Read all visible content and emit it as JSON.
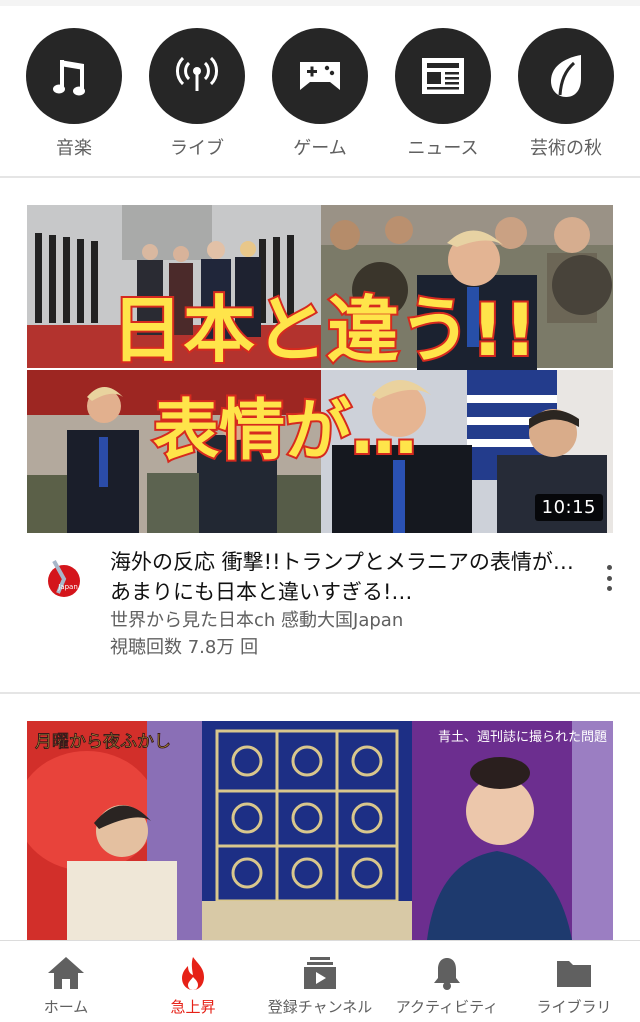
{
  "categories": [
    {
      "label": "音楽",
      "icon": "music-note-icon"
    },
    {
      "label": "ライブ",
      "icon": "live-broadcast-icon"
    },
    {
      "label": "ゲーム",
      "icon": "gamepad-icon"
    },
    {
      "label": "ニュース",
      "icon": "newspaper-icon"
    },
    {
      "label": "芸術の秋",
      "icon": "leaf-icon"
    }
  ],
  "video1": {
    "thumbnail_text_line1": "日本と違う!!",
    "thumbnail_text_line2": "表情が…",
    "duration": "10:15",
    "title": "海外の反応 衝撃!!トランプとメラニアの表情が…あまりにも日本と違いすぎる!…",
    "channel": "世界から見た日本ch 感動大国Japan",
    "views": "視聴回数 7.8万 回",
    "avatar_text": "Japan"
  },
  "video2": {
    "caption_left": "月曜から夜ふかし",
    "caption_right": "青土、週刊誌に撮られた問題"
  },
  "bottom_nav": [
    {
      "label": "ホーム",
      "icon": "home-icon"
    },
    {
      "label": "急上昇",
      "icon": "flame-icon"
    },
    {
      "label": "登録チャンネル",
      "icon": "subscriptions-icon"
    },
    {
      "label": "アクティビティ",
      "icon": "bell-icon"
    },
    {
      "label": "ライブラリ",
      "icon": "folder-icon"
    }
  ],
  "colors": {
    "accent": "#e62117",
    "chip_bg": "#262626",
    "secondary_text": "#606060"
  }
}
